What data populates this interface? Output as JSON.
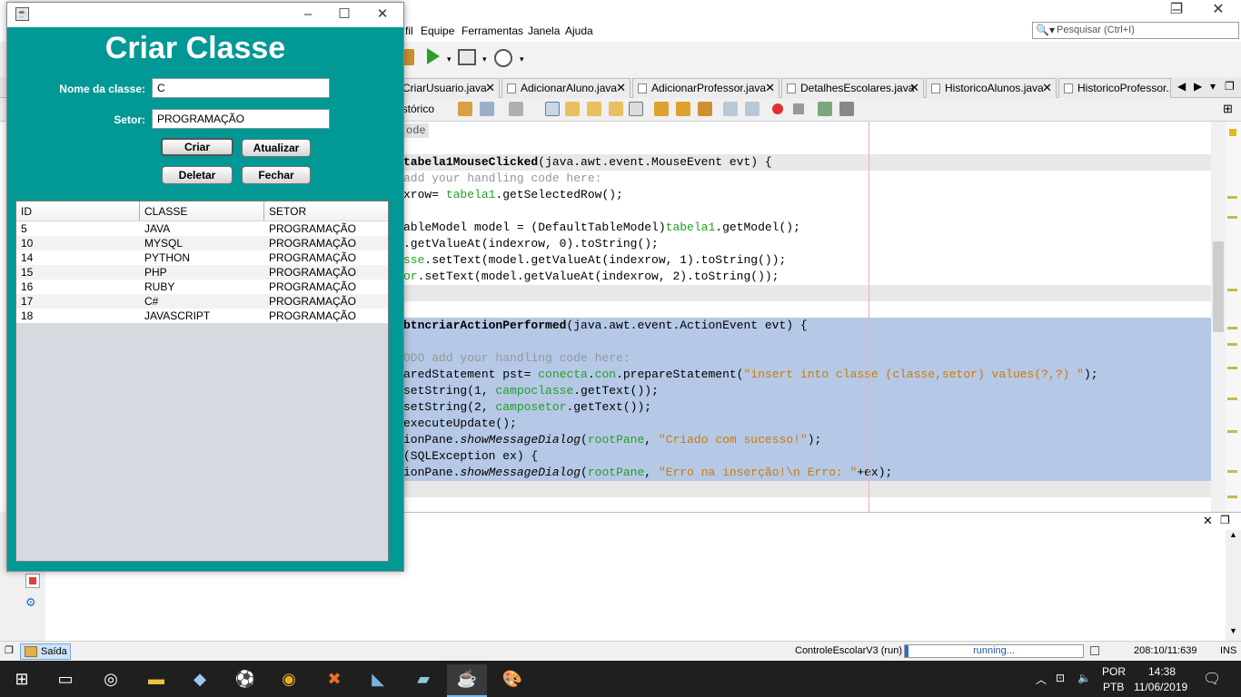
{
  "ide": {
    "menu": [
      "fil",
      "Equipe",
      "Ferramentas",
      "Janela",
      "Ajuda"
    ],
    "search_placeholder": "Pesquisar (Ctrl+I)",
    "tabs": [
      "CriarUsuario.java",
      "AdicionarAluno.java",
      "AdicionarProfessor.java",
      "DetalhesEscolares.java",
      "HistoricoAlunos.java",
      "HistoricoProfessor...."
    ],
    "editor_view_label": "istórico",
    "code_label": "ode",
    "status": {
      "output_tab": "Saída",
      "project": "ControleEscolarV3 (run)",
      "progress_text": "running...",
      "position": "208:10/11:639",
      "mode": "INS"
    }
  },
  "code": [
    {
      "segments": [
        {
          "t": "tabela1MouseClicked",
          "c": "bold"
        },
        {
          "t": "(java.awt.event.MouseEvent ",
          "c": ""
        },
        {
          "t": "evt",
          "c": ""
        },
        {
          "t": ") {",
          "c": ""
        }
      ],
      "bg": "grey"
    },
    {
      "segments": [
        {
          "t": "add your handling code here:",
          "c": "cmt"
        }
      ],
      "bg": ""
    },
    {
      "segments": [
        {
          "t": "xrow= ",
          "c": ""
        },
        {
          "t": "tabela1",
          "c": "g"
        },
        {
          "t": ".getSelectedRow();",
          "c": ""
        }
      ],
      "bg": ""
    },
    {
      "segments": [],
      "bg": ""
    },
    {
      "segments": [
        {
          "t": "ableModel model = (DefaultTableModel)",
          "c": ""
        },
        {
          "t": "tabela1",
          "c": "g"
        },
        {
          "t": ".getModel();",
          "c": ""
        }
      ],
      "bg": ""
    },
    {
      "segments": [
        {
          "t": ".getValueAt(indexrow, 0).toString();",
          "c": ""
        }
      ],
      "bg": ""
    },
    {
      "segments": [
        {
          "t": "sse",
          "c": "g"
        },
        {
          "t": ".setText(model.getValueAt(indexrow, 1).toString());",
          "c": ""
        }
      ],
      "bg": ""
    },
    {
      "segments": [
        {
          "t": "or",
          "c": "g"
        },
        {
          "t": ".setText(model.getValueAt(indexrow, 2).toString());",
          "c": ""
        }
      ],
      "bg": ""
    },
    {
      "segments": [],
      "bg": "grey"
    },
    {
      "segments": [],
      "bg": ""
    },
    {
      "segments": [
        {
          "t": "btncriarActionPerformed",
          "c": "bold"
        },
        {
          "t": "(java.awt.event.ActionEvent ",
          "c": ""
        },
        {
          "t": "evt",
          "c": ""
        },
        {
          "t": ") {",
          "c": ""
        }
      ],
      "bg": "sel"
    },
    {
      "segments": [],
      "bg": "sel"
    },
    {
      "segments": [
        {
          "t": "ODO add your handling code here:",
          "c": "cmt"
        }
      ],
      "bg": "sel"
    },
    {
      "segments": [
        {
          "t": "aredStatement pst= ",
          "c": ""
        },
        {
          "t": "conecta",
          "c": "g"
        },
        {
          "t": ".",
          "c": ""
        },
        {
          "t": "con",
          "c": "g"
        },
        {
          "t": ".prepareStatement(",
          "c": ""
        },
        {
          "t": "\"insert into classe (classe,setor) values(?,?) \"",
          "c": "str"
        },
        {
          "t": ");",
          "c": ""
        }
      ],
      "bg": "sel"
    },
    {
      "segments": [
        {
          "t": "setString(1, ",
          "c": ""
        },
        {
          "t": "campoclasse",
          "c": "g"
        },
        {
          "t": ".getText());",
          "c": ""
        }
      ],
      "bg": "sel"
    },
    {
      "segments": [
        {
          "t": "setString(2, ",
          "c": ""
        },
        {
          "t": "camposetor",
          "c": "g"
        },
        {
          "t": ".getText());",
          "c": ""
        }
      ],
      "bg": "sel"
    },
    {
      "segments": [
        {
          "t": "executeUpdate();",
          "c": ""
        }
      ],
      "bg": "sel"
    },
    {
      "segments": [
        {
          "t": "ionPane.",
          "c": ""
        },
        {
          "t": "showMessageDialog",
          "c": "it"
        },
        {
          "t": "(",
          "c": ""
        },
        {
          "t": "rootPane",
          "c": "g"
        },
        {
          "t": ", ",
          "c": ""
        },
        {
          "t": "\"Criado com sucesso!\"",
          "c": "str"
        },
        {
          "t": ");",
          "c": ""
        }
      ],
      "bg": "sel"
    },
    {
      "segments": [
        {
          "t": "(SQLException ex) {",
          "c": ""
        }
      ],
      "bg": "sel"
    },
    {
      "segments": [
        {
          "t": "ionPane.",
          "c": ""
        },
        {
          "t": "showMessageDialog",
          "c": "it"
        },
        {
          "t": "(",
          "c": ""
        },
        {
          "t": "rootPane",
          "c": "g"
        },
        {
          "t": ", ",
          "c": ""
        },
        {
          "t": "\"Erro na inserção!\\n Erro: \"",
          "c": "str"
        },
        {
          "t": "+ex);",
          "c": ""
        }
      ],
      "bg": "sel"
    },
    {
      "segments": [],
      "bg": "grey"
    }
  ],
  "dialog": {
    "heading": "Criar Classe",
    "name_label": "Nome da classe:",
    "name_value": "C",
    "sector_label": "Setor:",
    "sector_value": "PROGRAMAÇÃO",
    "buttons": {
      "create": "Criar",
      "update": "Atualizar",
      "delete": "Deletar",
      "close": "Fechar"
    },
    "table": {
      "columns": [
        "ID",
        "CLASSE",
        "SETOR"
      ],
      "rows": [
        [
          "5",
          "JAVA",
          "PROGRAMAÇÃO"
        ],
        [
          "10",
          "MYSQL",
          "PROGRAMAÇÃO"
        ],
        [
          "14",
          "PYTHON",
          "PROGRAMAÇÃO"
        ],
        [
          "15",
          "PHP",
          "PROGRAMAÇÃO"
        ],
        [
          "16",
          "RUBY",
          "PROGRAMAÇÃO"
        ],
        [
          "17",
          "C#",
          "PROGRAMAÇÃO"
        ],
        [
          "18",
          "JAVASCRIPT",
          "PROGRAMAÇÃO"
        ]
      ]
    }
  },
  "taskbar": {
    "lang": "POR",
    "layout": "PTB",
    "time": "14:38",
    "date": "11/06/2019"
  },
  "colors": {
    "dialog_bg": "#029895",
    "selection": "#b5c8e6"
  }
}
